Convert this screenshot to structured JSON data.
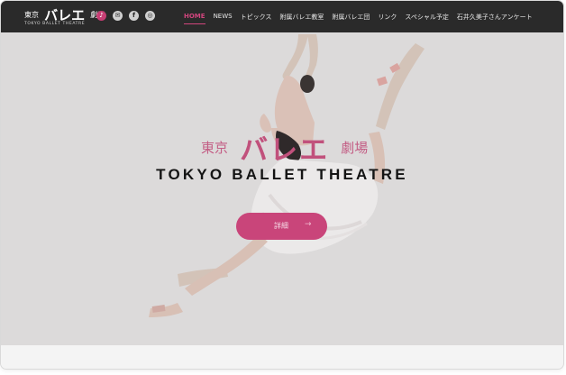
{
  "header": {
    "logo_prefix": "東京",
    "logo_main": "バレエ",
    "logo_suffix": "劇場",
    "logo_subtitle": "TOKYO BALLET THEATRE",
    "social_icons": [
      {
        "name": "pink-circle-icon",
        "glyph": "♪"
      },
      {
        "name": "mail-icon",
        "glyph": "✉"
      },
      {
        "name": "facebook-icon",
        "glyph": "f"
      },
      {
        "name": "instagram-icon",
        "glyph": "◎"
      }
    ],
    "nav": [
      "HOME",
      "NEWS",
      "トピックス",
      "附属バレエ教室",
      "附属バレエ団",
      "リンク",
      "スペシャル予定",
      "石井久美子さんアンケート"
    ],
    "active_nav": "HOME"
  },
  "hero": {
    "brand_prefix": "東京",
    "brand_main": "バレエ",
    "brand_suffix": "劇場",
    "title": "TOKYO BALLET THEATRE",
    "button_label": "詳細",
    "button_arrow": "→"
  },
  "colors": {
    "accent": "#c9457a",
    "topbar": "#2a2a2a",
    "hero_bg": "#e6e4e4"
  }
}
